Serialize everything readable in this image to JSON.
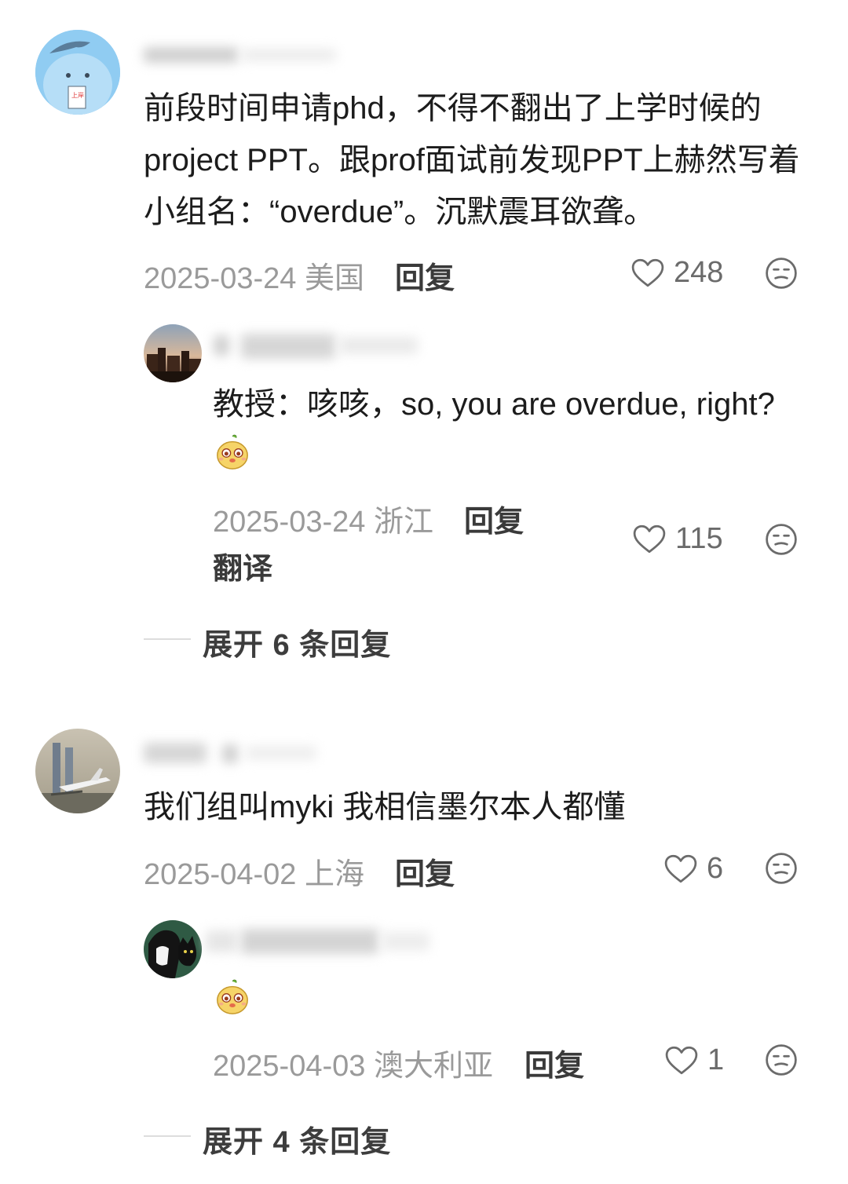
{
  "comments": [
    {
      "text": "前段时间申请phd，不得不翻出了上学时候的project PPT。跟prof面试前发现PPT上赫然写着小组名：“overdue”。沉默震耳欲聋。",
      "date": "2025-03-24",
      "location": "美国",
      "reply_label": "回复",
      "likes": "248",
      "avatar_icon": "blue-cartoon-avatar",
      "reply": {
        "text": "教授：咳咳，so, you are overdue, right?",
        "emoji_icon": "chick-emoji",
        "date": "2025-03-24",
        "location": "浙江",
        "reply_label": "回复",
        "translate_label": "翻译",
        "likes": "115",
        "avatar_icon": "city-night-avatar"
      },
      "expand_label": "展开 6 条回复"
    },
    {
      "text": "我们组叫myki 我相信墨尔本人都懂",
      "date": "2025-04-02",
      "location": "上海",
      "reply_label": "回复",
      "likes": "6",
      "avatar_icon": "twin-towers-plane-avatar",
      "reply": {
        "emoji_icon": "chick-emoji",
        "date": "2025-04-03",
        "location": "澳大利亚",
        "reply_label": "回复",
        "likes": "1",
        "avatar_icon": "anime-cat-avatar"
      },
      "expand_label": "展开 4 条回复"
    }
  ],
  "colors": {
    "meta_gray": "#9a9a9a",
    "text": "#1c1c1c"
  }
}
